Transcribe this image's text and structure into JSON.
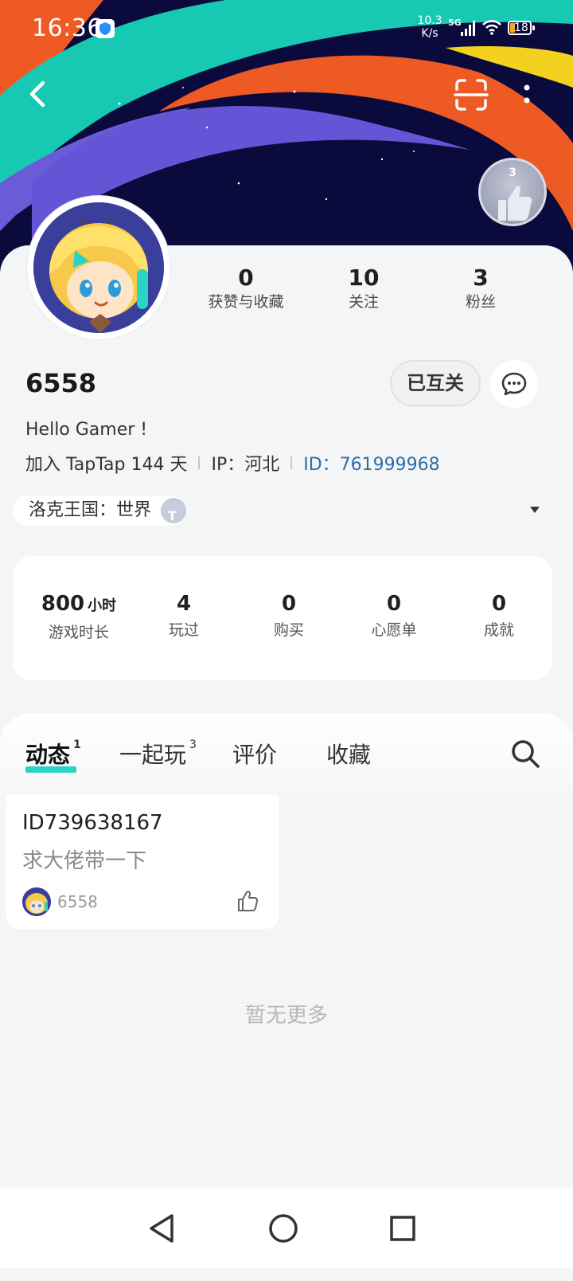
{
  "status_bar": {
    "time": "16:36",
    "speed_value": "10.3",
    "speed_unit": "K/s",
    "network": "5G",
    "battery": "18"
  },
  "header": {
    "back_icon": "chevron-left-icon",
    "scan_icon": "scan-icon",
    "more_icon": "more-vertical-icon",
    "likes_medal_count": "3"
  },
  "profile": {
    "stats": [
      {
        "value": "0",
        "label": "获赞与收藏"
      },
      {
        "value": "10",
        "label": "关注"
      },
      {
        "value": "3",
        "label": "粉丝"
      }
    ],
    "username": "6558",
    "follow_status": "已互关",
    "bio": "Hello Gamer !",
    "joined": "加入 TapTap 144 天",
    "ip": "IP：河北",
    "id": "ID：761999968"
  },
  "game_tag": {
    "text": "洛克王国：世界"
  },
  "game_stats": [
    {
      "value": "800",
      "unit": "小时",
      "label": "游戏时长"
    },
    {
      "value": "4",
      "unit": "",
      "label": "玩过"
    },
    {
      "value": "0",
      "unit": "",
      "label": "购买"
    },
    {
      "value": "0",
      "unit": "",
      "label": "心愿单"
    },
    {
      "value": "0",
      "unit": "",
      "label": "成就"
    }
  ],
  "tabs": [
    {
      "label": "动态",
      "count": "1",
      "active": true
    },
    {
      "label": "一起玩",
      "count": "3",
      "active": false
    },
    {
      "label": "评价",
      "count": "",
      "active": false
    },
    {
      "label": "收藏",
      "count": "",
      "active": false
    }
  ],
  "post": {
    "title": "ID739638167",
    "body": "求大佬带一下",
    "author": "6558"
  },
  "footer_text": "暂无更多",
  "colors": {
    "accent": "#2ad4c4",
    "link": "#2c6ea6",
    "banner_bg": "#0a0a3c"
  }
}
